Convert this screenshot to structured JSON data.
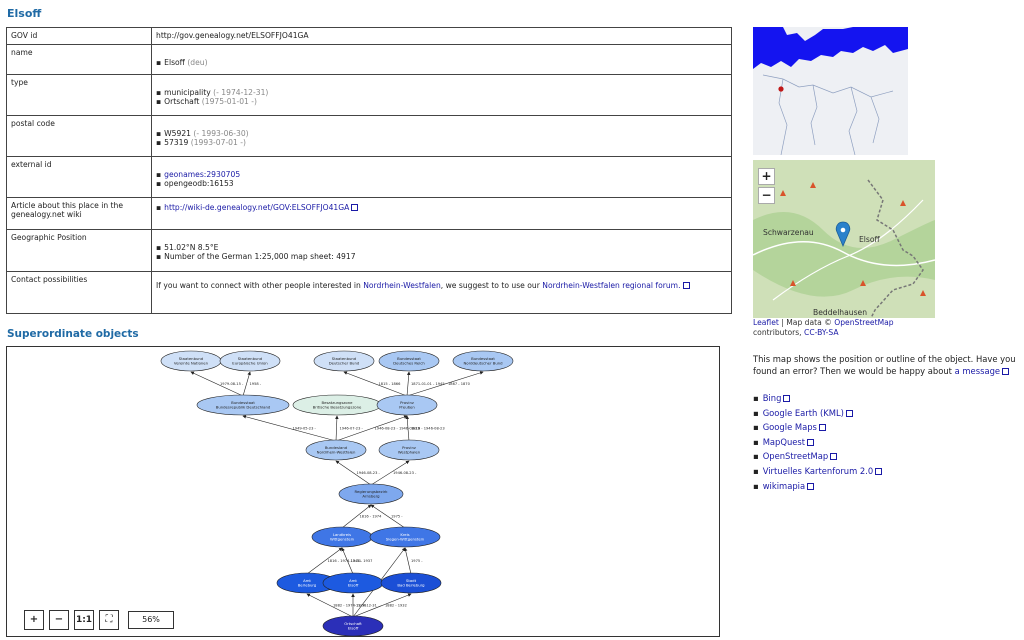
{
  "title": "Elsoff",
  "rows": {
    "gov_id": {
      "label": "GOV id",
      "value": "http://gov.genealogy.net/ELSOFFJO41GA"
    },
    "name": {
      "label": "name",
      "value": "Elsoff",
      "extra": "(deu)"
    },
    "type": {
      "label": "type",
      "items": [
        {
          "text": "municipality",
          "extra": "(- 1974-12-31)"
        },
        {
          "text": "Ortschaft",
          "extra": "(1975-01-01 -)"
        }
      ]
    },
    "postal": {
      "label": "postal code",
      "items": [
        {
          "text": "W5921",
          "extra": "(- 1993-06-30)"
        },
        {
          "text": "57319",
          "extra": "(1993-07-01 -)"
        }
      ]
    },
    "external": {
      "label": "external id",
      "link": "geonames:2930705",
      "other": "opengeodb:16153"
    },
    "article": {
      "label": "Article about this place in the genealogy.net wiki",
      "link": "http://wiki-de.genealogy.net/GOV:ELSOFFJO41GA"
    },
    "geo": {
      "label": "Geographic Position",
      "items": [
        "51.02°N 8.5°E",
        "Number of the German 1:25,000 map sheet: 4917"
      ]
    },
    "contact": {
      "label": "Contact possibilities",
      "text1": "If you want to connect with other people interested in",
      "link1": "Nordrhein-Westfalen",
      "text2": ", we suggest to to use our",
      "link2": "Nordrhein-Westfalen regional forum."
    }
  },
  "superordinate_title": "Superordinate objects",
  "graph": {
    "nodes": [
      {
        "id": "n1",
        "l1": "Staatenbund",
        "l2": "Vereinte Nationen",
        "c": "#cfe0f7"
      },
      {
        "id": "n2",
        "l1": "Staatenbund",
        "l2": "Europäische Union",
        "c": "#cfe0f7"
      },
      {
        "id": "n3",
        "l1": "Staatenbund",
        "l2": "Deutscher Bund",
        "c": "#cfe0f7"
      },
      {
        "id": "n4",
        "l1": "Bundesstaat",
        "l2": "Deutsches Reich",
        "c": "#a9c8f3"
      },
      {
        "id": "n5",
        "l1": "Bundesstaat",
        "l2": "Norddeutscher Bund",
        "c": "#a9c8f3"
      },
      {
        "id": "n6",
        "l1": "Bundesstaat",
        "l2": "Bundesrepublik Deutschland",
        "c": "#a9c8f3"
      },
      {
        "id": "n7",
        "l1": "Besatzungszone",
        "l2": "Britische Besatzungszone",
        "c": "#dcefe6"
      },
      {
        "id": "n8",
        "l1": "Provinz",
        "l2": "Preußen",
        "c": "#a9c8f3"
      },
      {
        "id": "n9",
        "l1": "Bundesland",
        "l2": "Nordrhein-Westfalen",
        "c": "#a9c8f3"
      },
      {
        "id": "n10",
        "l1": "Provinz",
        "l2": "Westphalen",
        "c": "#a9c8f3"
      },
      {
        "id": "n11",
        "l1": "Regierungsbezirk",
        "l2": "Arnsberg",
        "c": "#7ea8ee"
      },
      {
        "id": "n12",
        "l1": "Landkreis",
        "l2": "Wittgenstein",
        "c": "#3f76e6"
      },
      {
        "id": "n13",
        "l1": "Kreis",
        "l2": "Siegen-Wittgenstein",
        "c": "#3f76e6"
      },
      {
        "id": "n14",
        "l1": "Amt",
        "l2": "Berleburg",
        "c": "#1d5ae0"
      },
      {
        "id": "n15",
        "l1": "Amt",
        "l2": "Elsoff",
        "c": "#1d5ae0"
      },
      {
        "id": "n16",
        "l1": "Stadt",
        "l2": "Bad Berleburg",
        "c": "#1b4fd6"
      },
      {
        "id": "n17",
        "l1": "Ortschaft",
        "l2": "Elsoff",
        "c": "#2b2fb8"
      }
    ],
    "edge_labels": [
      "1979-08-15 -",
      "1958 -",
      "1815 - 1866",
      "1871-01-01 - 1945",
      "1867 - 1870",
      "1949-05-23 -",
      "1946-07-23 -",
      "1946-08-23 - 1946-08-23",
      "1816 - 1946-08-23",
      "1946-08-23 -",
      "1946-08-23 -",
      "1816 - 1974",
      "1975 -",
      "1816 - 1974-12-31",
      "1945 - 1937",
      "1975 -",
      "1882 - 1974-12-31",
      "1974-12-31",
      "1882 - 1932",
      "1975 -"
    ]
  },
  "zoom": {
    "plus": "+",
    "minus": "−",
    "one": "1:1",
    "fit": "⛶",
    "percent": "56%"
  },
  "minimap": {
    "marker_color": "#c01818",
    "water_color": "#1414f0"
  },
  "osm": {
    "zoom_in": "+",
    "zoom_out": "−",
    "labels": [
      "Schwarzenau",
      "Elsoff",
      "Beddelhausen"
    ],
    "marker_icon": "map-pin-icon"
  },
  "attribution": {
    "leaflet": "Leaflet",
    "sep": " | Map data © ",
    "osm": "OpenStreetMap",
    "contributors": "contributors,",
    "license": "CC-BY-SA"
  },
  "map_note": {
    "text": "This map shows the position or outline of the object. Have you found an error? Then we would be happy about",
    "link": "a message"
  },
  "links": [
    "Bing",
    "Google Earth (KML)",
    "Google Maps",
    "MapQuest",
    "OpenStreetMap",
    "Virtuelles Kartenforum 2.0",
    "wikimapia"
  ]
}
